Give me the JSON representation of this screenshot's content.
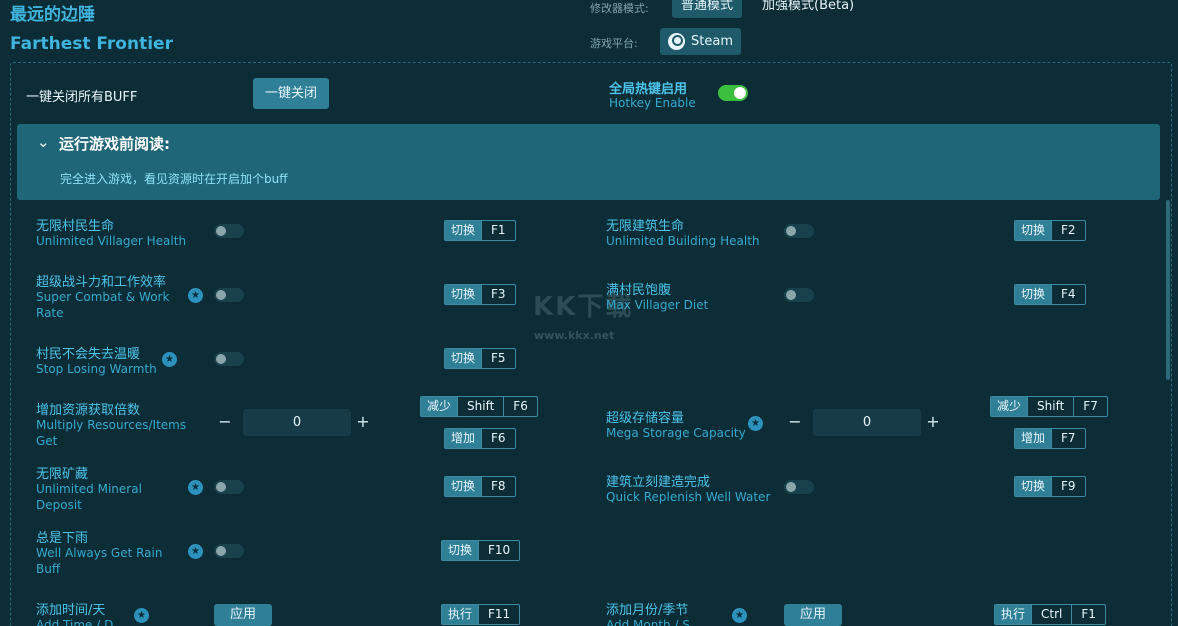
{
  "app": {
    "title_cn": "最远的边陲",
    "title_en": "Farthest Frontier"
  },
  "header": {
    "mode_label": "修改器模式:",
    "mode_normal": "普通模式",
    "mode_enhanced": "加强模式(Beta)",
    "platform_label": "游戏平台:",
    "platform": "Steam"
  },
  "topbar": {
    "close_all_label": "一键关闭所有BUFF",
    "close_all_button": "一键关闭",
    "hotkey_cn": "全局热键启用",
    "hotkey_en": "Hotkey Enable"
  },
  "notice": {
    "title": "运行游戏前阅读:",
    "body": "完全进入游戏，看见资源时在开启加个buff"
  },
  "common": {
    "toggle": "切换",
    "decrease": "减少",
    "increase": "增加",
    "execute": "执行",
    "apply": "应用",
    "star": "★"
  },
  "features": {
    "f1": {
      "cn": "无限村民生命",
      "en": "Unlimited Villager Health",
      "key": "F1"
    },
    "f2": {
      "cn": "无限建筑生命",
      "en": "Unlimited Building Health",
      "key": "F2"
    },
    "f3": {
      "cn": "超级战斗力和工作效率",
      "en1": "Super Combat & Work",
      "en2": "Rate",
      "key": "F3"
    },
    "f4": {
      "cn": "满村民饱腹",
      "en": "Max Villager Diet",
      "key": "F4"
    },
    "f5": {
      "cn": "村民不会失去温暖",
      "en": "Stop Losing Warmth",
      "key": "F5"
    },
    "f6": {
      "cn": "增加资源获取倍数",
      "en1": "Multiply Resources/Items",
      "en2": "Get",
      "mod": "Shift",
      "key_dec": "F6",
      "key_inc": "F6",
      "value": "0"
    },
    "f7": {
      "cn": "超级存储容量",
      "en": "Mega Storage Capacity",
      "mod": "Shift",
      "key_dec": "F7",
      "key_inc": "F7",
      "value": "0"
    },
    "f8": {
      "cn": "无限矿藏",
      "en1": "Unlimited Mineral",
      "en2": "Deposit",
      "key": "F8"
    },
    "f9": {
      "cn": "建筑立刻建造完成",
      "en": "Quick Replenish Well Water",
      "key": "F9"
    },
    "f10": {
      "cn": "总是下雨",
      "en1": "Well Always Get Rain",
      "en2": "Buff",
      "key": "F10"
    },
    "f11": {
      "cn": "添加时间/天",
      "en": "Add Time / D",
      "key": "F11"
    },
    "f12": {
      "cn": "添加月份/季节",
      "en": "Add Month / S",
      "mod": "Ctrl",
      "key": "F1"
    }
  },
  "watermark": {
    "logo": "KK下载",
    "url": "www.kkx.net"
  },
  "colors": {
    "bg": "#0c2c36",
    "accent": "#3fb4dd",
    "toggle_on": "#3bbf3f",
    "notice_bg": "#1e6678"
  }
}
